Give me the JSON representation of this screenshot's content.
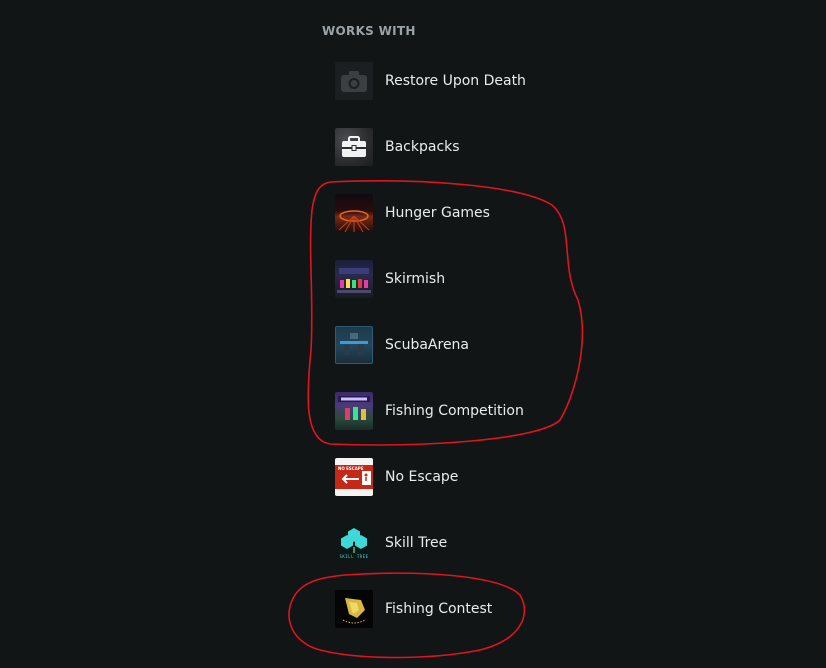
{
  "section": {
    "title": "WORKS WITH"
  },
  "items": [
    {
      "label": "Restore Upon Death",
      "icon": "camera-icon"
    },
    {
      "label": "Backpacks",
      "icon": "backpack-icon"
    },
    {
      "label": "Hunger Games",
      "icon": "hunger-games-thumbnail"
    },
    {
      "label": "Skirmish",
      "icon": "skirmish-thumbnail"
    },
    {
      "label": "ScubaArena",
      "icon": "scuba-arena-thumbnail"
    },
    {
      "label": "Fishing Competition",
      "icon": "fishing-competition-thumbnail"
    },
    {
      "label": "No Escape",
      "icon": "no-escape-thumbnail",
      "thumb_text": "NO ESCAPE"
    },
    {
      "label": "Skill Tree",
      "icon": "skill-tree-thumbnail",
      "thumb_text": "SKILL TREE"
    },
    {
      "label": "Fishing Contest",
      "icon": "fishing-contest-thumbnail"
    }
  ],
  "annotation": {
    "color": "#e0141e"
  }
}
